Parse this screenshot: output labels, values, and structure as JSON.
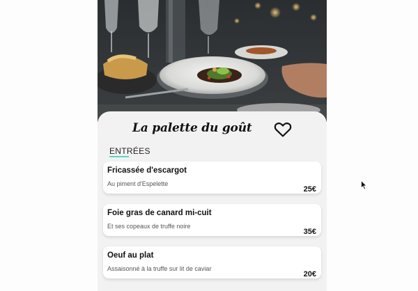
{
  "restaurant": {
    "title": "La palette du goût"
  },
  "icons": {
    "favorite": "heart-outline-icon",
    "cursor": "mouse-pointer-icon"
  },
  "menu": {
    "section_label": "ENTRÉES",
    "accent_color": "#5ad6c4",
    "items": [
      {
        "name": "Fricassée d'escargot",
        "description": "Au piment d'Espelette",
        "price": "25€"
      },
      {
        "name": "Foie gras de canard mi-cuit",
        "description": "Et ses copeaux de truffe noire",
        "price": "35€"
      },
      {
        "name": "Oeuf au plat",
        "description": "Assaisonné à la truffe sur lit de caviar",
        "price": "20€"
      }
    ]
  }
}
